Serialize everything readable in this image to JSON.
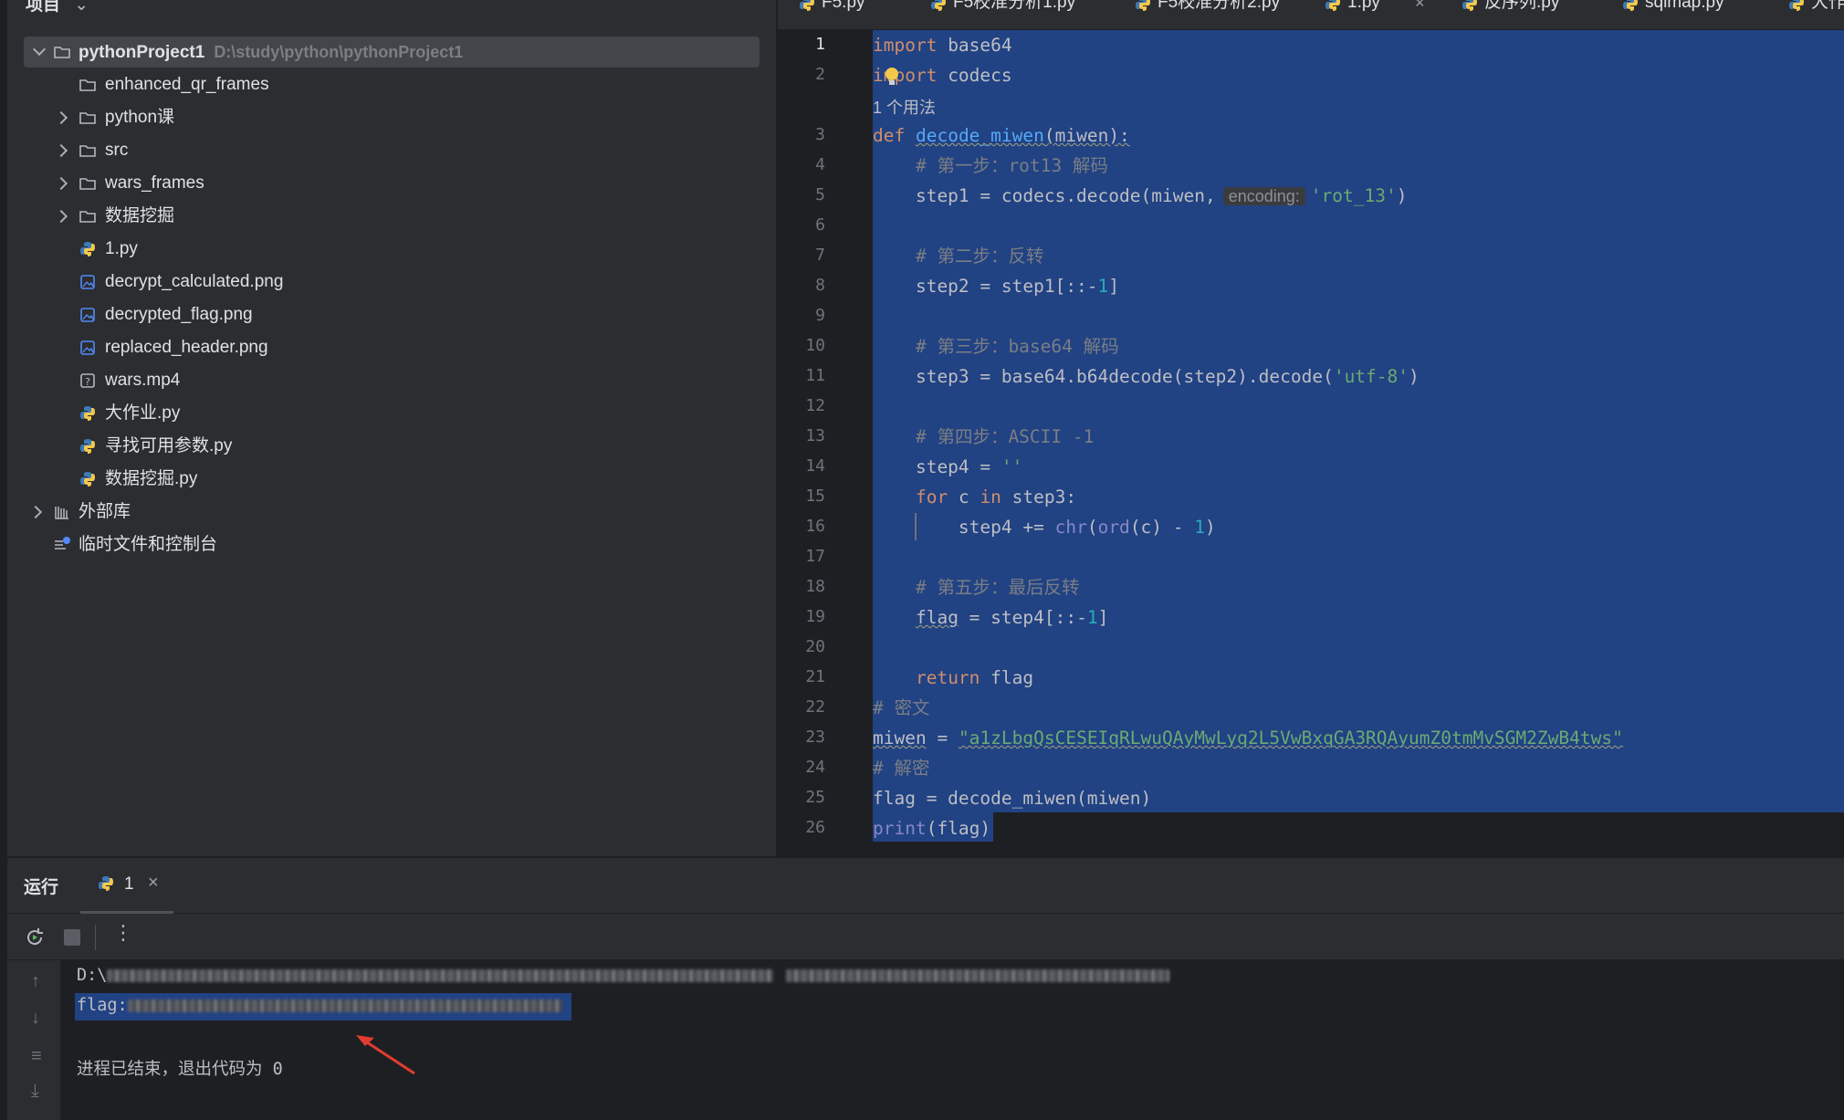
{
  "project_panel": {
    "title": "项目",
    "root": {
      "name": "pythonProject1",
      "path": "D:\\study\\python\\pythonProject1"
    },
    "items": [
      {
        "name": "enhanced_qr_frames",
        "type": "folder",
        "expandable": false
      },
      {
        "name": "python课",
        "type": "folder",
        "expandable": true
      },
      {
        "name": "src",
        "type": "folder",
        "expandable": true
      },
      {
        "name": "wars_frames",
        "type": "folder",
        "expandable": true
      },
      {
        "name": "数据挖掘",
        "type": "folder",
        "expandable": true
      },
      {
        "name": "1.py",
        "type": "python"
      },
      {
        "name": "decrypt_calculated.png",
        "type": "image"
      },
      {
        "name": "decrypted_flag.png",
        "type": "image"
      },
      {
        "name": "replaced_header.png",
        "type": "image"
      },
      {
        "name": "wars.mp4",
        "type": "unknown"
      },
      {
        "name": "大作业.py",
        "type": "python"
      },
      {
        "name": "寻找可用参数.py",
        "type": "python"
      },
      {
        "name": "数据挖掘.py",
        "type": "python"
      }
    ],
    "external_libs": "外部库",
    "scratches": "临时文件和控制台"
  },
  "editor": {
    "tabs": [
      {
        "label": "F5.py"
      },
      {
        "label": "F5校准分析1.py"
      },
      {
        "label": "F5校准分析2.py"
      },
      {
        "label": "1.py",
        "active": true
      },
      {
        "label": "反序列.py"
      },
      {
        "label": "sqlmap.py"
      },
      {
        "label": "大作"
      }
    ],
    "line_numbers": [
      "1",
      "2",
      "3",
      "4",
      "5",
      "6",
      "7",
      "8",
      "9",
      "10",
      "11",
      "12",
      "13",
      "14",
      "15",
      "16",
      "17",
      "18",
      "19",
      "20",
      "21",
      "22",
      "23",
      "24",
      "25",
      "26"
    ],
    "usage_hint": "1 个用法",
    "param_hint": "encoding:",
    "code": {
      "l1a": "import",
      "l1b": " base64",
      "l2a": "import",
      "l2b": " codecs",
      "l3a": "def",
      "l3b": "decode_miwen",
      "l3c": "(miwen):",
      "l4": "    # 第一步：rot13 解码",
      "l5a": "    step1 = codecs.decode(miwen,",
      "l5b": "'rot_13'",
      "l5c": ")",
      "l7": "    # 第二步：反转",
      "l8a": "    step2 = step1[::-",
      "l8b": "1",
      "l8c": "]",
      "l10": "    # 第三步：base64 解码",
      "l11a": "    step3 = base64.b64decode(step2).decode(",
      "l11b": "'utf-8'",
      "l11c": ")",
      "l13": "    # 第四步：ASCII -1",
      "l14a": "    step4 = ",
      "l14b": "''",
      "l15a": "    ",
      "l15b": "for",
      "l15c": " c ",
      "l15d": "in",
      "l15e": " step3:",
      "l16a": "        step4 += ",
      "l16b": "chr",
      "l16c": "(",
      "l16d": "ord",
      "l16e": "(c) - ",
      "l16f": "1",
      "l16g": ")",
      "l18": "    # 第五步：最后反转",
      "l19a": "    ",
      "l19b": "flag",
      "l19c": " = step4[::-",
      "l19d": "1",
      "l19e": "]",
      "l21a": "    ",
      "l21b": "return",
      "l21c": " flag",
      "l22": "# 密文",
      "l23a": "miwen",
      "l23b": " = ",
      "l23c": "\"a1zLbgQsCESEIqRLwuQAyMwLyq2L5VwBxqGA3RQAyumZ0tmMvSGM2ZwB4tws\"",
      "l24": "# 解密",
      "l25": "flag = decode_miwen(miwen)",
      "l26a": "print",
      "l26b": "(flag)"
    }
  },
  "run_panel": {
    "title": "运行",
    "tab_label": "1",
    "console": {
      "line1_prefix": "D:\\",
      "line2_prefix": "flag:",
      "exit_message": "进程已结束，退出代码为 0"
    }
  },
  "colors": {
    "selection": "#214283",
    "keyword": "#cf8e6d",
    "string": "#6aab73",
    "function": "#56a8f5",
    "comment": "#7a7e85",
    "number": "#2aacb8"
  }
}
